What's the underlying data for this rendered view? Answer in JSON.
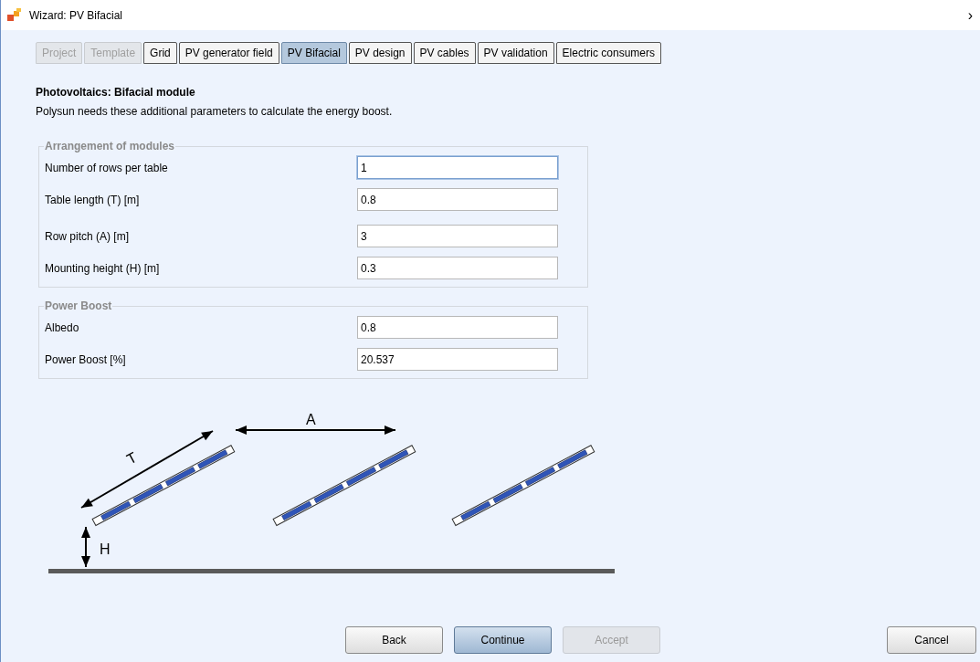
{
  "window": {
    "title": "Wizard: PV Bifacial",
    "nav_glyph": "›"
  },
  "tabs": [
    {
      "label": "Project",
      "selected": false,
      "disabled": true
    },
    {
      "label": "Template",
      "selected": false,
      "disabled": true
    },
    {
      "label": "Grid",
      "selected": false,
      "disabled": false
    },
    {
      "label": "PV generator field",
      "selected": false,
      "disabled": false
    },
    {
      "label": "PV Bifacial",
      "selected": true,
      "disabled": false
    },
    {
      "label": "PV design",
      "selected": false,
      "disabled": false
    },
    {
      "label": "PV cables",
      "selected": false,
      "disabled": false
    },
    {
      "label": "PV validation",
      "selected": false,
      "disabled": false
    },
    {
      "label": "Electric consumers",
      "selected": false,
      "disabled": false
    }
  ],
  "heading": "Photovoltaics: Bifacial module",
  "description": "Polysun needs these additional parameters to calculate the energy boost.",
  "groups": [
    {
      "title": "Arrangement of modules",
      "fields": [
        {
          "label": "Number of rows per table",
          "value": "1",
          "focused": true
        },
        {
          "label": "Table length (T) [m]",
          "value": "0.8",
          "focused": false
        },
        {
          "label": "Row pitch (A) [m]",
          "value": "3",
          "focused": false
        },
        {
          "label": "Mounting height (H) [m]",
          "value": "0.3",
          "focused": false
        }
      ]
    },
    {
      "title": "Power Boost",
      "fields": [
        {
          "label": "Albedo",
          "value": "0.8",
          "focused": false
        },
        {
          "label": "Power Boost [%]",
          "value": "20.537",
          "focused": false
        }
      ]
    }
  ],
  "diagram": {
    "length_label": "T",
    "pitch_label": "A",
    "height_label": "H"
  },
  "buttons": [
    {
      "label": "Back",
      "kind": "default",
      "disabled": false
    },
    {
      "label": "Continue",
      "kind": "primary",
      "disabled": false
    },
    {
      "label": "Accept",
      "kind": "default",
      "disabled": true
    },
    {
      "label": "Cancel",
      "kind": "cancel",
      "disabled": false
    }
  ]
}
